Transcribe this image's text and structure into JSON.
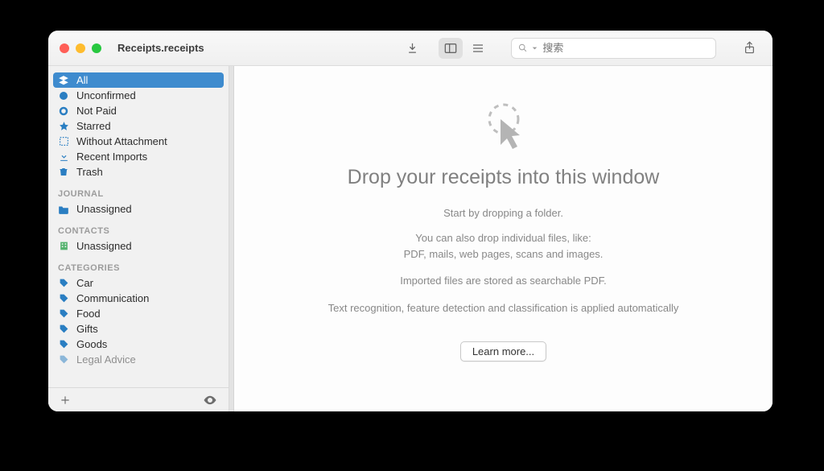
{
  "window": {
    "title": "Receipts.receipts"
  },
  "toolbar": {
    "search_placeholder": "搜索"
  },
  "sidebar": {
    "filters": [
      {
        "label": "All",
        "icon": "stack"
      },
      {
        "label": "Unconfirmed",
        "icon": "dot"
      },
      {
        "label": "Not Paid",
        "icon": "ring"
      },
      {
        "label": "Starred",
        "icon": "star"
      },
      {
        "label": "Without Attachment",
        "icon": "dashed"
      },
      {
        "label": "Recent Imports",
        "icon": "download"
      },
      {
        "label": "Trash",
        "icon": "trash"
      }
    ],
    "sections": {
      "journal": {
        "header": "JOURNAL",
        "items": [
          {
            "label": "Unassigned"
          }
        ]
      },
      "contacts": {
        "header": "CONTACTS",
        "items": [
          {
            "label": "Unassigned"
          }
        ]
      },
      "categories": {
        "header": "CATEGORIES",
        "items": [
          {
            "label": "Car"
          },
          {
            "label": "Communication"
          },
          {
            "label": "Food"
          },
          {
            "label": "Gifts"
          },
          {
            "label": "Goods"
          },
          {
            "label": "Legal Advice"
          }
        ]
      }
    }
  },
  "main": {
    "heading": "Drop your receipts into this window",
    "lead": "Start by dropping a folder.",
    "line1": "You can also drop individual files, like:",
    "line2": "PDF, mails, web pages, scans and images.",
    "line3": "Imported files are stored as searchable PDF.",
    "line4": "Text recognition, feature detection and classification is applied automatically",
    "learn_more": "Learn more..."
  }
}
